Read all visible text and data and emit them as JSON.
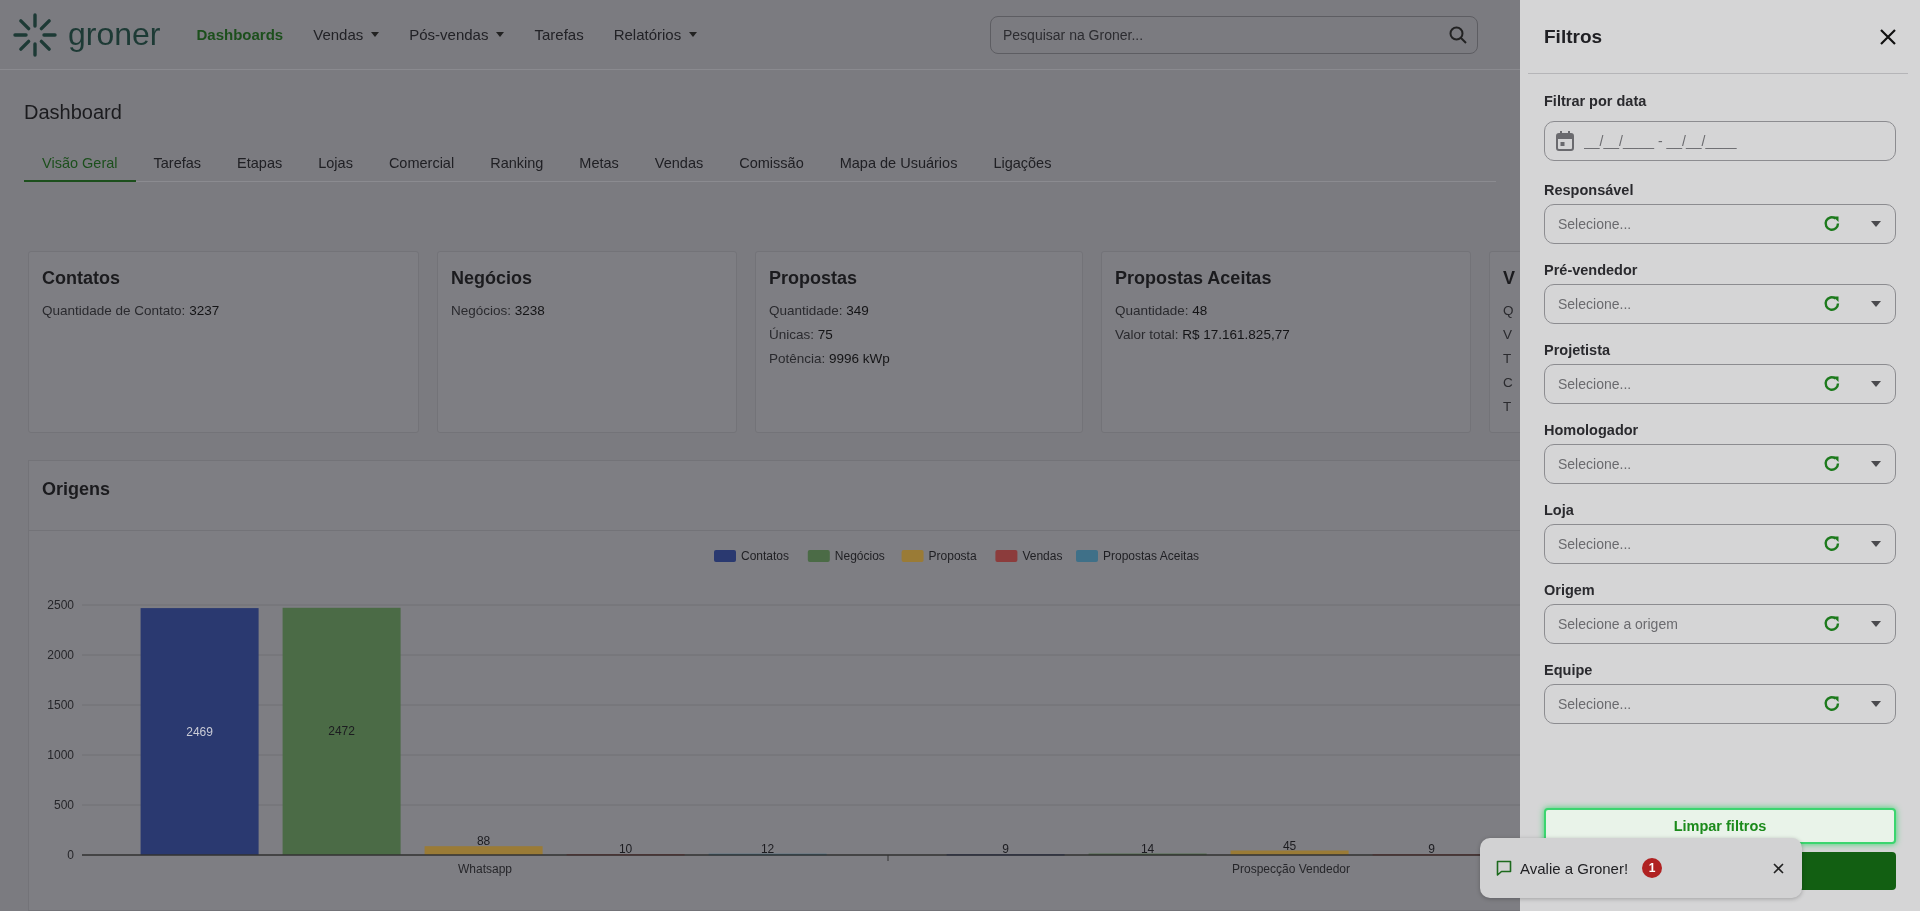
{
  "header": {
    "logo": "groner",
    "nav": [
      {
        "label": "Dashboards",
        "selected": true,
        "dropdown": false
      },
      {
        "label": "Vendas",
        "selected": false,
        "dropdown": true
      },
      {
        "label": "Pós-vendas",
        "selected": false,
        "dropdown": true
      },
      {
        "label": "Tarefas",
        "selected": false,
        "dropdown": false
      },
      {
        "label": "Relatórios",
        "selected": false,
        "dropdown": true
      }
    ],
    "search": {
      "placeholder": "Pesquisar na Groner..."
    }
  },
  "page": {
    "title": "Dashboard",
    "tabs": [
      {
        "label": "Visão Geral",
        "selected": true
      },
      {
        "label": "Tarefas",
        "selected": false
      },
      {
        "label": "Etapas",
        "selected": false
      },
      {
        "label": "Lojas",
        "selected": false
      },
      {
        "label": "Comercial",
        "selected": false
      },
      {
        "label": "Ranking",
        "selected": false
      },
      {
        "label": "Metas",
        "selected": false
      },
      {
        "label": "Vendas",
        "selected": false
      },
      {
        "label": "Comissão",
        "selected": false
      },
      {
        "label": "Mapa de Usuários",
        "selected": false
      },
      {
        "label": "Ligações",
        "selected": false
      }
    ]
  },
  "cards": [
    {
      "title": "Contatos",
      "lines": [
        {
          "label": "Quantidade de Contato:",
          "value": "3237"
        }
      ]
    },
    {
      "title": "Negócios",
      "lines": [
        {
          "label": "Negócios:",
          "value": "3238"
        }
      ]
    },
    {
      "title": "Propostas",
      "lines": [
        {
          "label": "Quantidade:",
          "value": "349"
        },
        {
          "label": "Únicas:",
          "value": "75"
        },
        {
          "label": "Potência:",
          "value": "9996 kWp"
        }
      ]
    },
    {
      "title": "Propostas Aceitas",
      "lines": [
        {
          "label": "Quantidade:",
          "value": "48"
        },
        {
          "label": "Valor total:",
          "value": "R$ 17.161.825,77"
        }
      ]
    },
    {
      "title": "V",
      "lines": [
        {
          "label": "Q"
        },
        {
          "label": "V"
        },
        {
          "label": "T"
        },
        {
          "label": "C"
        },
        {
          "label": "T"
        }
      ]
    }
  ],
  "origins": {
    "chart_data": {
      "type": "bar",
      "title": "Origens",
      "categories": [
        "Whatsapp",
        "Prospecção Vendedor"
      ],
      "ylim": [
        0,
        2500
      ],
      "grid": true,
      "legend": true,
      "yticks": [
        0,
        500,
        1000,
        1500,
        2000,
        2500
      ],
      "data_labels": true,
      "series": [
        {
          "name": "Contatos",
          "color": "#2a3970",
          "values": [
            2469,
            9
          ]
        },
        {
          "name": "Negócios",
          "color": "#4b6b46",
          "values": [
            2472,
            14
          ]
        },
        {
          "name": "Proposta",
          "color": "#9a7b36",
          "values": [
            88,
            45
          ]
        },
        {
          "name": "Vendas",
          "color": "#8c3c3c",
          "values": [
            10,
            9
          ]
        },
        {
          "name": "Propostas Aceitas",
          "color": "#3f7088",
          "values": [
            12,
            null
          ]
        }
      ]
    }
  },
  "filters": {
    "title": "Filtros",
    "date": {
      "label": "Filtrar por data",
      "placeholder": "__/__/____ - __/__/____"
    },
    "selects": [
      {
        "label": "Responsável",
        "placeholder": "Selecione..."
      },
      {
        "label": "Pré-vendedor",
        "placeholder": "Selecione..."
      },
      {
        "label": "Projetista",
        "placeholder": "Selecione..."
      },
      {
        "label": "Homologador",
        "placeholder": "Selecione..."
      },
      {
        "label": "Loja",
        "placeholder": "Selecione..."
      },
      {
        "label": "Origem",
        "placeholder": "Selecione a origem"
      },
      {
        "label": "Equipe",
        "placeholder": "Selecione..."
      }
    ],
    "clear_button": "Limpar filtros"
  },
  "toast": {
    "text": "Avalie a Groner!",
    "badge": "1"
  }
}
